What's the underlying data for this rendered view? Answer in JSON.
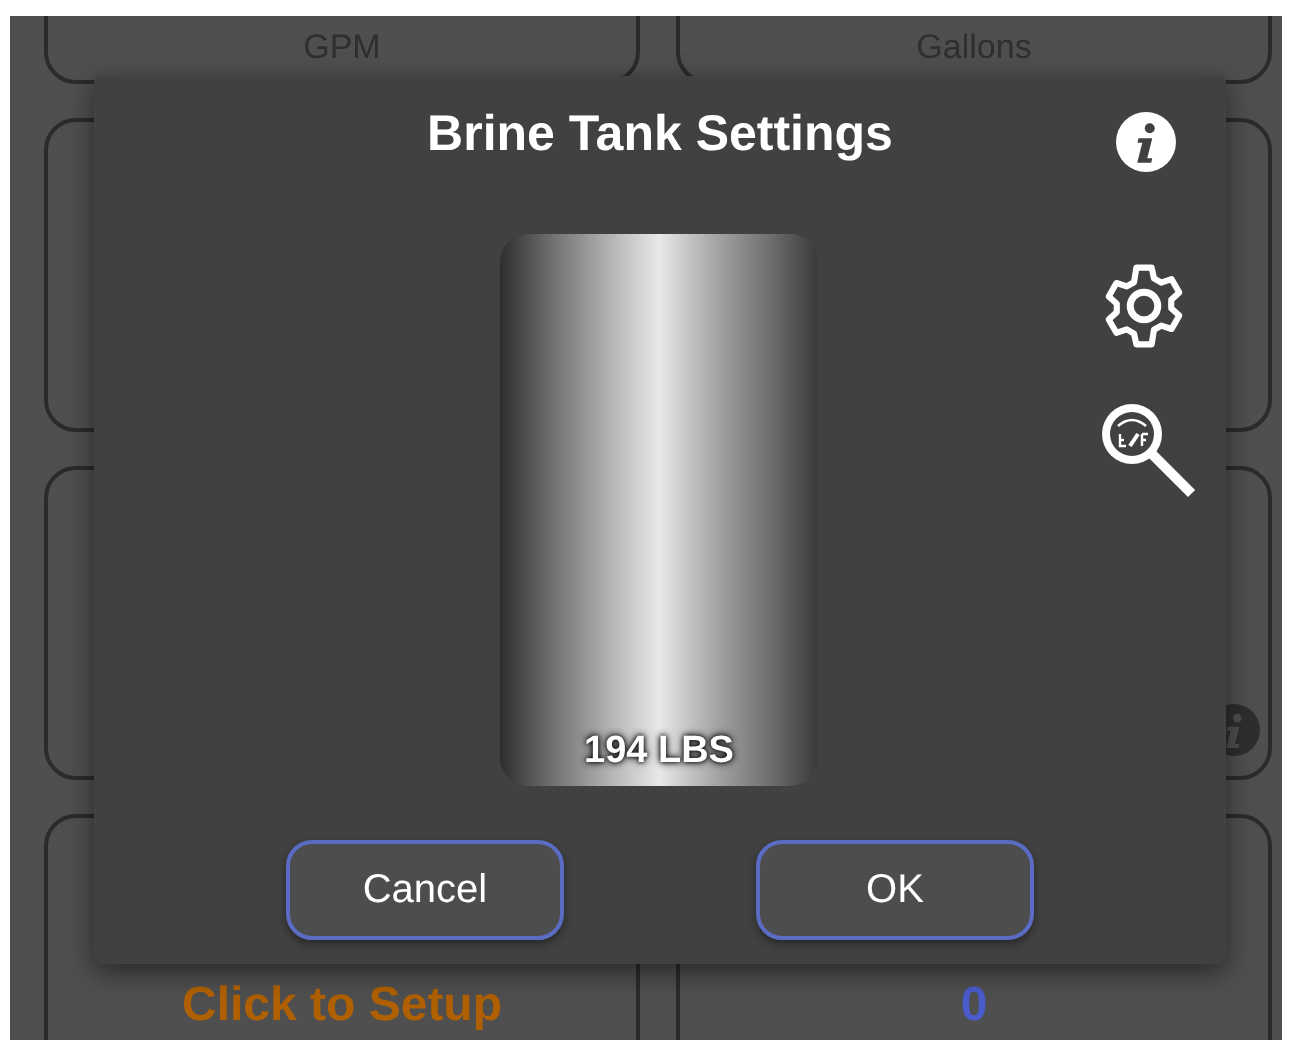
{
  "background": {
    "cards": [
      {
        "kind": "label",
        "text": "GPM"
      },
      {
        "kind": "label",
        "text": "Gallons"
      },
      {
        "kind": "blank"
      },
      {
        "kind": "blank"
      },
      {
        "kind": "blank"
      },
      {
        "kind": "info"
      },
      {
        "kind": "value",
        "text": "Click to Setup",
        "color": "#b06000"
      },
      {
        "kind": "value",
        "text": "0",
        "color": "#4a5ccc"
      }
    ]
  },
  "dialog": {
    "title": "Brine Tank Settings",
    "tank_reading": "194 LBS",
    "buttons": [
      {
        "label": "Cancel"
      },
      {
        "label": "OK"
      }
    ]
  }
}
